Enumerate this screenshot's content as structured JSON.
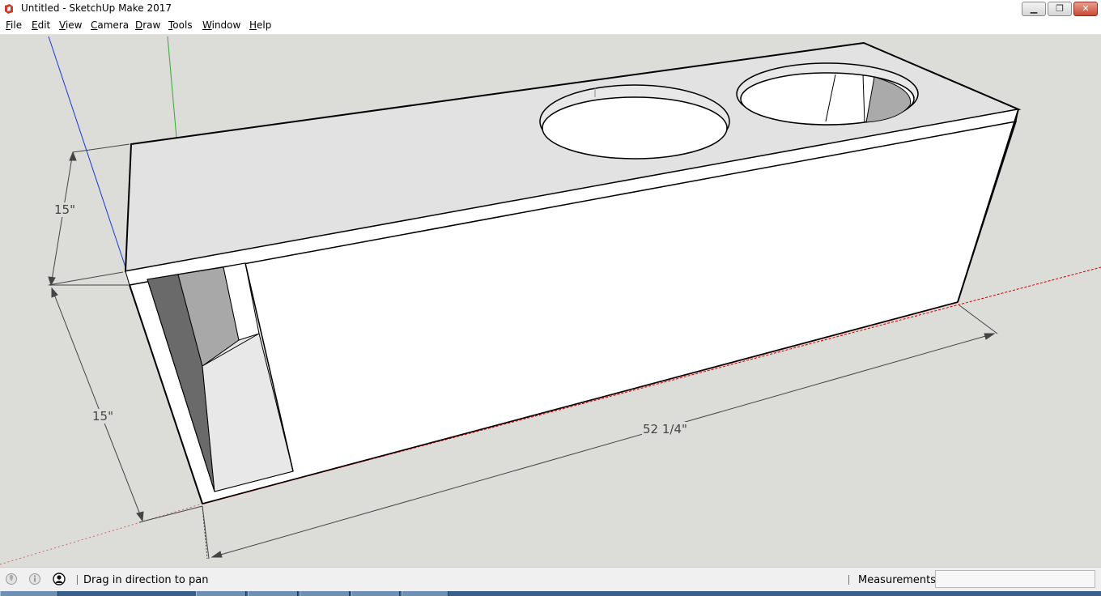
{
  "window": {
    "title": "Untitled - SketchUp Make 2017",
    "app_icon": "sketchup-logo-icon",
    "controls": [
      "minimize-icon",
      "restore-icon",
      "close-icon"
    ]
  },
  "menu": {
    "items": [
      {
        "label": "File"
      },
      {
        "label": "Edit"
      },
      {
        "label": "View"
      },
      {
        "label": "Camera"
      },
      {
        "label": "Draw"
      },
      {
        "label": "Tools"
      },
      {
        "label": "Window"
      },
      {
        "label": "Help"
      }
    ]
  },
  "viewport": {
    "dimensions": {
      "top_height": "15\"",
      "front_height": "15\"",
      "length": "52 1/4\""
    },
    "axis_colors": {
      "x": "#cc0000",
      "y": "#33aa33",
      "z": "#2233cc"
    },
    "face_color": "#ffffff",
    "background": "#dcdcd8"
  },
  "statusbar": {
    "icons": [
      "geo-location-icon",
      "credits-icon",
      "user-account-icon"
    ],
    "message": "Drag in direction to pan",
    "measurements_label": "Measurements",
    "measurements_value": ""
  }
}
